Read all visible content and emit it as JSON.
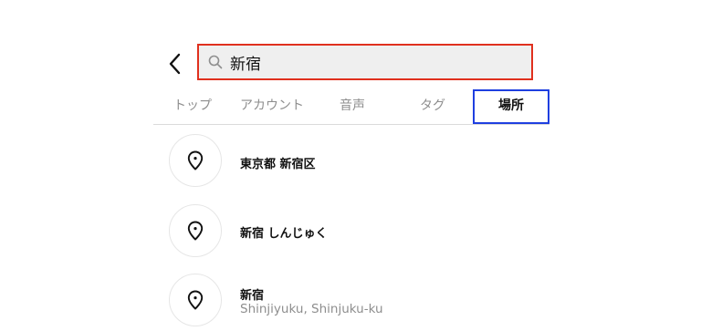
{
  "header": {
    "back_icon": "chevron-left-icon",
    "search": {
      "icon": "search-icon",
      "value": "新宿",
      "highlight_color": "#e0301e"
    }
  },
  "tabs": [
    {
      "label": "トップ",
      "active": false
    },
    {
      "label": "アカウント",
      "active": false
    },
    {
      "label": "音声",
      "active": false
    },
    {
      "label": "タグ",
      "active": false
    },
    {
      "label": "場所",
      "active": true
    }
  ],
  "active_tab_highlight_color": "#1f3fe0",
  "results": [
    {
      "icon": "location-pin-icon",
      "title": "東京都 新宿区",
      "subtitle": ""
    },
    {
      "icon": "location-pin-icon",
      "title": "新宿 しんじゅく",
      "subtitle": ""
    },
    {
      "icon": "location-pin-icon",
      "title": "新宿",
      "subtitle": "Shinjiyuku, Shinjuku-ku"
    }
  ]
}
